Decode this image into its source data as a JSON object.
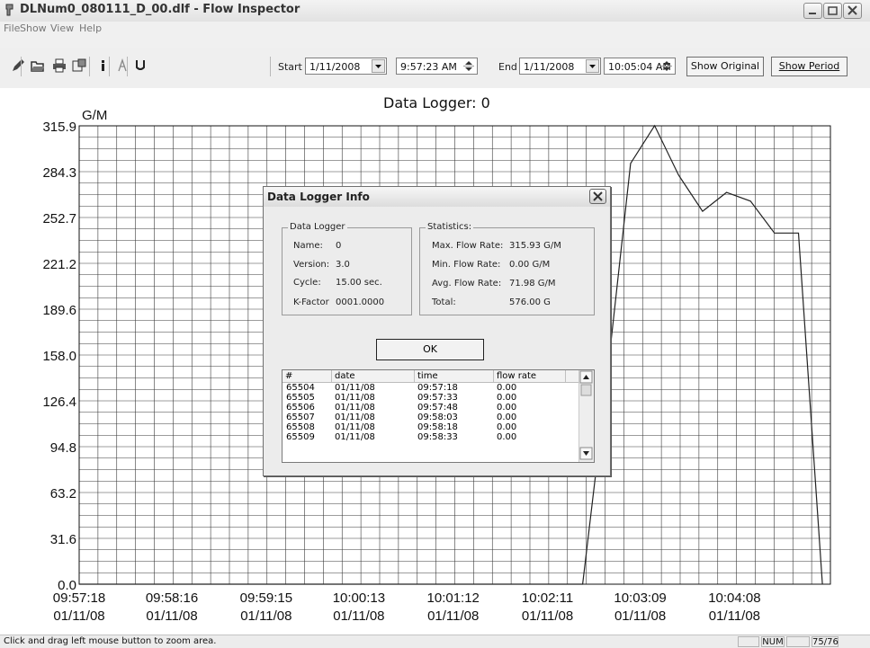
{
  "window": {
    "title": "DLNum0_080111_D_00.dlf - Flow Inspector"
  },
  "menu": [
    "File",
    "Show",
    "View",
    "Help"
  ],
  "toolbar": {
    "icons": [
      "pencil-icon",
      "open-folder-icon",
      "print-icon",
      "settings-icon",
      "info-icon",
      "font-icon",
      "underline-icon"
    ],
    "start_label": "Start",
    "start_date": "1/11/2008",
    "start_time": "9:57:23 AM",
    "end_label": "End",
    "end_date": "1/11/2008",
    "end_time": "10:05:04 AM",
    "show_original": "Show Original",
    "show_period": "Show Period"
  },
  "chart_data": {
    "type": "line",
    "title": "Data Logger: 0",
    "ylabel": "G/M",
    "ylim": [
      0,
      315.9
    ],
    "yticks": [
      "315.9",
      "284.3",
      "252.7",
      "221.2",
      "189.6",
      "158.0",
      "126.4",
      "94.8",
      "63.2",
      "31.6",
      "0.0"
    ],
    "xticks": [
      [
        "09:57:18",
        "01/11/08"
      ],
      [
        "09:58:16",
        "01/11/08"
      ],
      [
        "09:59:15",
        "01/11/08"
      ],
      [
        "10:00:13",
        "01/11/08"
      ],
      [
        "10:01:12",
        "01/11/08"
      ],
      [
        "10:02:11",
        "01/11/08"
      ],
      [
        "10:03:09",
        "01/11/08"
      ],
      [
        "10:04:08",
        "01/11/08"
      ]
    ],
    "x_start": "09:57:18",
    "x_end": "10:05:08",
    "series": [
      {
        "points": [
          [
            "09:57:18",
            0
          ],
          [
            "10:02:11",
            0
          ],
          [
            "10:02:33",
            0
          ],
          [
            "10:02:48",
            140
          ],
          [
            "10:03:03",
            290
          ],
          [
            "10:03:18",
            316
          ],
          [
            "10:03:33",
            282
          ],
          [
            "10:03:48",
            257
          ],
          [
            "10:04:03",
            270
          ],
          [
            "10:04:18",
            264
          ],
          [
            "10:04:33",
            242
          ],
          [
            "10:04:48",
            242
          ],
          [
            "10:05:03",
            0
          ]
        ]
      }
    ],
    "grid": true
  },
  "dialog": {
    "title": "Data Logger Info",
    "logger_group": "Data Logger",
    "logger": [
      {
        "label": "Name:",
        "value": "0"
      },
      {
        "label": "Version:",
        "value": "3.0"
      },
      {
        "label": "Cycle:",
        "value": "15.00 sec."
      },
      {
        "label": "K-Factor",
        "value": "0001.0000"
      }
    ],
    "stats_group": "Statistics:",
    "stats": [
      {
        "label": "Max. Flow Rate:",
        "value": "315.93 G/M"
      },
      {
        "label": "Min. Flow Rate:",
        "value": "0.00 G/M"
      },
      {
        "label": "Avg. Flow Rate:",
        "value": "71.98 G/M"
      },
      {
        "label": "Total:",
        "value": "576.00 G"
      }
    ],
    "ok_label": "OK",
    "list_columns": [
      "#",
      "date",
      "time",
      "flow rate"
    ],
    "list_rows": [
      [
        "65504",
        "01/11/08",
        "09:57:18",
        "0.00"
      ],
      [
        "65505",
        "01/11/08",
        "09:57:33",
        "0.00"
      ],
      [
        "65506",
        "01/11/08",
        "09:57:48",
        "0.00"
      ],
      [
        "65507",
        "01/11/08",
        "09:58:03",
        "0.00"
      ],
      [
        "65508",
        "01/11/08",
        "09:58:18",
        "0.00"
      ],
      [
        "65509",
        "01/11/08",
        "09:58:33",
        "0.00"
      ]
    ]
  },
  "statusbar": {
    "message": "Click and drag left mouse button to zoom area.",
    "num": "NUM",
    "page": "75/76"
  }
}
